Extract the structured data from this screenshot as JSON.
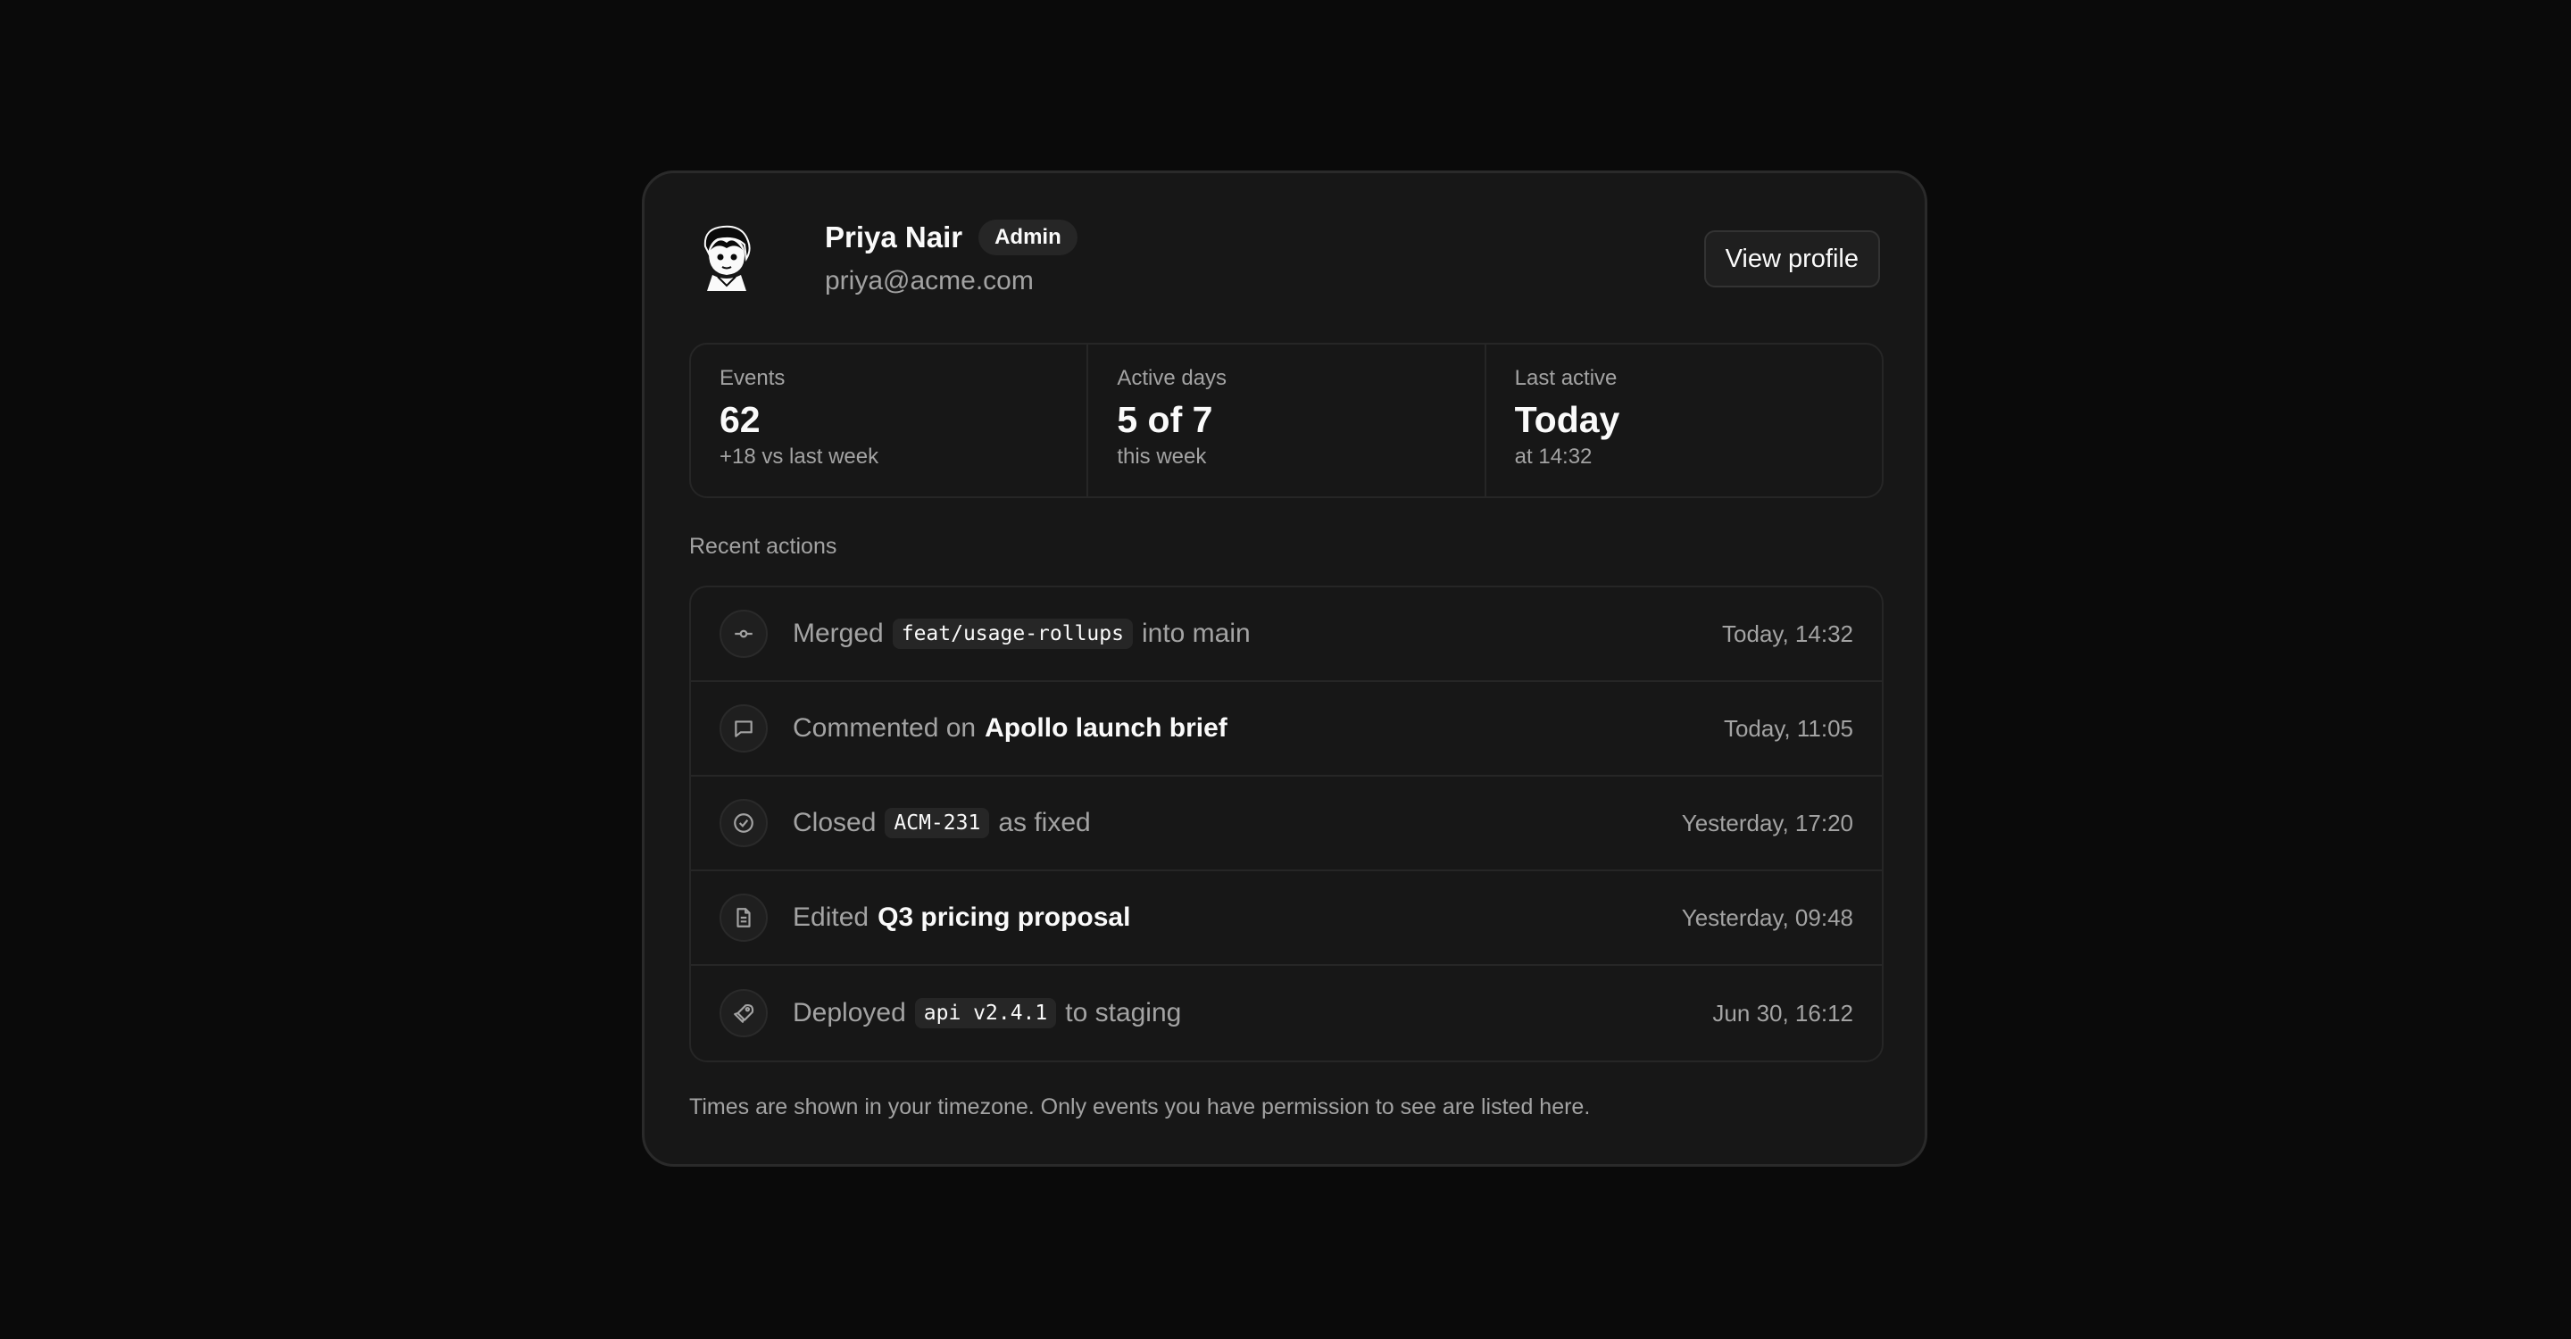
{
  "user": {
    "name": "Priya Nair",
    "role_badge": "Admin",
    "email": "priya@acme.com",
    "avatar_icon": "cartoon-avatar-icon"
  },
  "header": {
    "view_profile_label": "View profile"
  },
  "stats": [
    {
      "label": "Events",
      "value": "62",
      "sub": "+18 vs last week"
    },
    {
      "label": "Active days",
      "value": "5 of 7",
      "sub": "this week"
    },
    {
      "label": "Last active",
      "value": "Today",
      "sub": "at 14:32"
    }
  ],
  "recent": {
    "title": "Recent actions",
    "items": [
      {
        "icon": "git-commit-icon",
        "verb": "Merged",
        "object": "feat/usage-rollups",
        "object_style": "code",
        "suffix": "into main",
        "time": "Today, 14:32"
      },
      {
        "icon": "comment-icon",
        "verb": "Commented on",
        "object": "Apollo launch brief",
        "object_style": "strong",
        "suffix": "",
        "time": "Today, 11:05"
      },
      {
        "icon": "check-circle-icon",
        "verb": "Closed",
        "object": "ACM-231",
        "object_style": "code",
        "suffix": "as fixed",
        "time": "Yesterday, 17:20"
      },
      {
        "icon": "document-icon",
        "verb": "Edited",
        "object": "Q3 pricing proposal",
        "object_style": "strong",
        "suffix": "",
        "time": "Yesterday, 09:48"
      },
      {
        "icon": "rocket-icon",
        "verb": "Deployed",
        "object": "api v2.4.1",
        "object_style": "code",
        "suffix": "to staging",
        "time": "Jun 30, 16:12"
      }
    ]
  },
  "footer": {
    "note": "Times are shown in your timezone. Only events you have permission to see are listed here."
  }
}
